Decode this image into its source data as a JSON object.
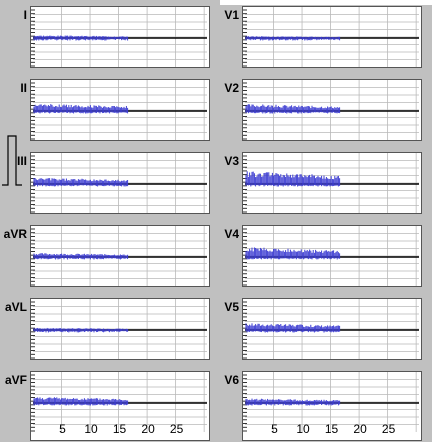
{
  "colors": {
    "background": "#c0c0c0",
    "panel": "#ffffff",
    "grid": "#b9b9b9",
    "baseline": "#000000",
    "trace": "#3c3cd2",
    "calibration": "#000000"
  },
  "x_ticks": [
    "5",
    "10",
    "15",
    "20",
    "25"
  ],
  "leads_left": [
    {
      "label": "I",
      "amplitude": 0.15,
      "duration": 0.55
    },
    {
      "label": "II",
      "amplitude": 0.55,
      "duration": 0.55
    },
    {
      "label": "III",
      "amplitude": 0.45,
      "duration": 0.55
    },
    {
      "label": "aVR",
      "amplitude": 0.25,
      "duration": 0.55
    },
    {
      "label": "aVL",
      "amplitude": 0.1,
      "duration": 0.55
    },
    {
      "label": "aVF",
      "amplitude": 0.45,
      "duration": 0.55
    }
  ],
  "leads_right": [
    {
      "label": "V1",
      "amplitude": 0.08,
      "duration": 0.55
    },
    {
      "label": "V2",
      "amplitude": 0.5,
      "duration": 0.55
    },
    {
      "label": "V3",
      "amplitude": 1.0,
      "duration": 0.55
    },
    {
      "label": "V4",
      "amplitude": 0.75,
      "duration": 0.55
    },
    {
      "label": "V5",
      "amplitude": 0.5,
      "duration": 0.55
    },
    {
      "label": "V6",
      "amplitude": 0.3,
      "duration": 0.55
    }
  ]
}
